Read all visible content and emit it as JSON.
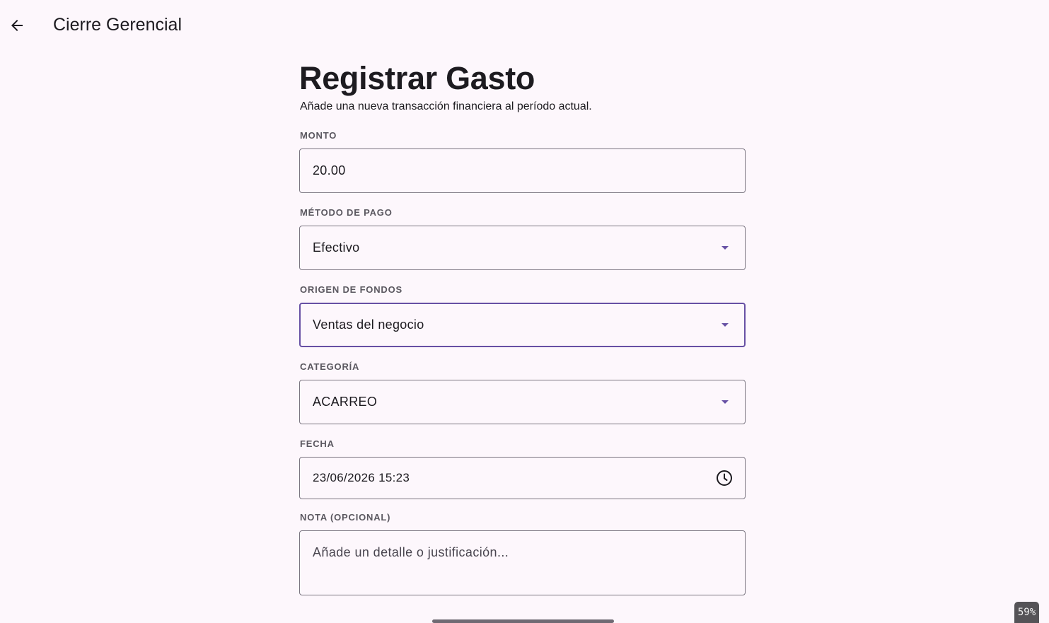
{
  "app_bar": {
    "title": "Cierre Gerencial",
    "back_icon": "arrow-left-icon"
  },
  "form": {
    "title": "Registrar Gasto",
    "subtitle": "Añade una nueva transacción financiera al período actual.",
    "monto": {
      "label": "MONTO",
      "value": "20.00"
    },
    "metodo_pago": {
      "label": "MÉTODO DE PAGO",
      "value": "Efectivo"
    },
    "origen_fondos": {
      "label": "ORIGEN DE FONDOS",
      "value": "Ventas del negocio"
    },
    "categoria": {
      "label": "CATEGORÍA",
      "value": "ACARREO"
    },
    "fecha": {
      "label": "FECHA",
      "value": "23/06/2026 15:23",
      "icon": "clock-icon"
    },
    "nota": {
      "label": "NOTA (OPCIONAL)",
      "placeholder": "Añade un detalle o justificación..."
    }
  },
  "status": {
    "battery": "59%"
  },
  "colors": {
    "accent": "#6750a4",
    "background": "#fdf7fc",
    "outline": "#7a7580",
    "label": "#5b5860"
  }
}
